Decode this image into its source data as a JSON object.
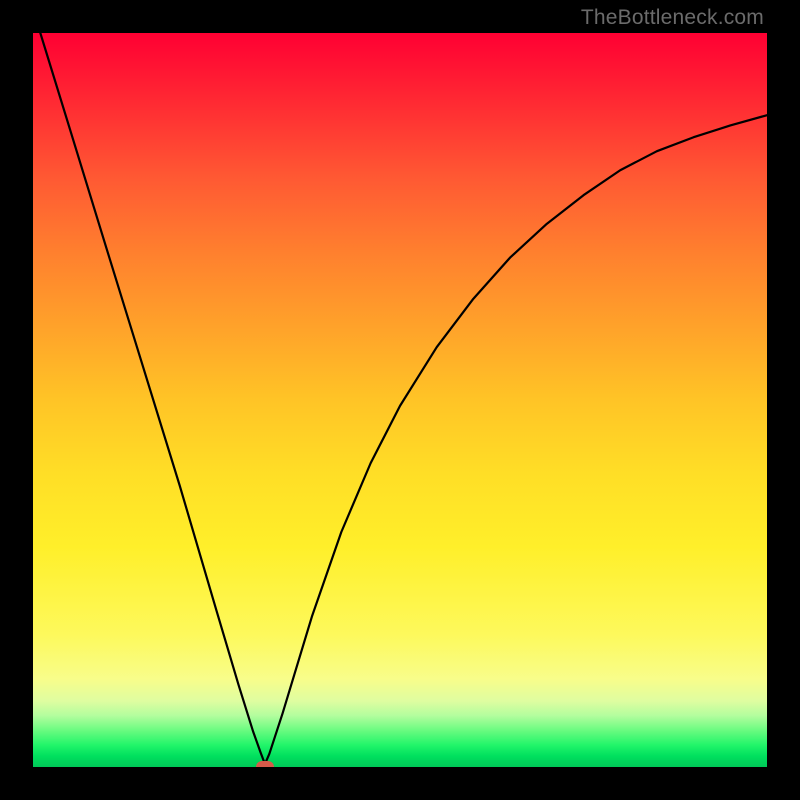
{
  "watermark": "TheBottleneck.com",
  "chart_data": {
    "type": "line",
    "title": "",
    "xlabel": "",
    "ylabel": "",
    "xlim": [
      0,
      1
    ],
    "ylim": [
      0,
      1
    ],
    "series": [
      {
        "name": "curve",
        "x": [
          0.01,
          0.05,
          0.1,
          0.15,
          0.2,
          0.25,
          0.28,
          0.3,
          0.31,
          0.316,
          0.322,
          0.34,
          0.38,
          0.42,
          0.46,
          0.5,
          0.55,
          0.6,
          0.65,
          0.7,
          0.75,
          0.8,
          0.85,
          0.9,
          0.95,
          1.0
        ],
        "values": [
          1.0,
          0.87,
          0.707,
          0.545,
          0.383,
          0.213,
          0.112,
          0.048,
          0.02,
          0.004,
          0.018,
          0.073,
          0.205,
          0.32,
          0.414,
          0.492,
          0.572,
          0.638,
          0.694,
          0.74,
          0.779,
          0.813,
          0.839,
          0.858,
          0.874,
          0.888
        ]
      }
    ],
    "marker": {
      "x": 0.316,
      "y": 0.0
    },
    "gradient_stops": [
      {
        "pos": 0.0,
        "color": "#ff0033"
      },
      {
        "pos": 0.5,
        "color": "#ffc426"
      },
      {
        "pos": 0.9,
        "color": "#f8fd8a"
      },
      {
        "pos": 1.0,
        "color": "#00c858"
      }
    ]
  }
}
